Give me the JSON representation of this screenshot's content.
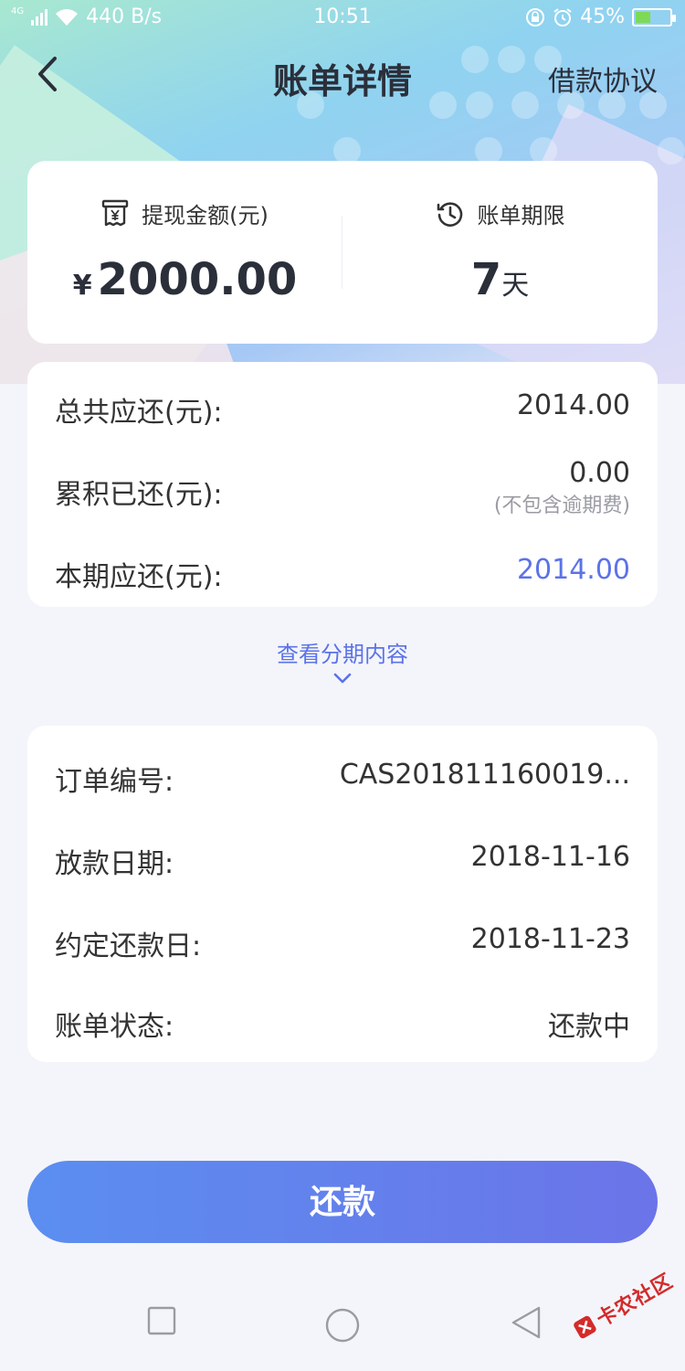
{
  "status_bar": {
    "network_type": "4G",
    "speed": "440 B/s",
    "time": "10:51",
    "battery_percent": "45%",
    "battery_level": 0.45,
    "icons": [
      "signal-icon",
      "wifi-icon",
      "lock-rotation-icon",
      "alarm-icon",
      "battery-icon"
    ]
  },
  "nav": {
    "title": "账单详情",
    "right_link": "借款协议"
  },
  "summary": {
    "withdraw_label": "提现金额(元)",
    "currency": "¥",
    "withdraw_amount": "2000.00",
    "term_label": "账单期限",
    "term_value": "7",
    "term_unit": "天"
  },
  "repayment": {
    "rows": [
      {
        "label": "总共应还(元):",
        "value": "2014.00"
      },
      {
        "label": "累积已还(元):",
        "value": "0.00",
        "note": "(不包含逾期费)"
      },
      {
        "label": "本期应还(元):",
        "value": "2014.00"
      }
    ],
    "accent_color": "#5b73e8"
  },
  "expand": {
    "label": "查看分期内容"
  },
  "order_info": {
    "rows": [
      {
        "label": "订单编号:",
        "value": "CAS201811160019..."
      },
      {
        "label": "放款日期:",
        "value": "2018-11-16"
      },
      {
        "label": "约定还款日:",
        "value": "2018-11-23"
      },
      {
        "label": "账单状态:",
        "value": "还款中"
      }
    ]
  },
  "action": {
    "repay_label": "还款"
  },
  "watermark": {
    "text": "卡农社区"
  }
}
